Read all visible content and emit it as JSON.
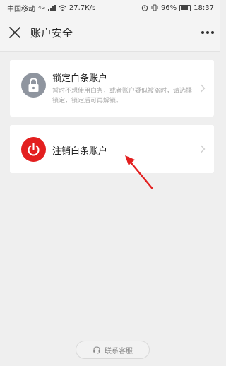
{
  "status_bar": {
    "carrier": "中国移动",
    "network": "4G",
    "speed": "27.7K/s",
    "battery": "96%",
    "time": "18:37"
  },
  "header": {
    "close_icon": "close-icon",
    "title": "账户安全",
    "more_icon": "more-icon"
  },
  "options": [
    {
      "icon": "lock-icon",
      "icon_bg": "#8f959f",
      "title": "锁定白条账户",
      "description": "暂时不想使用白条，或者账户疑似被盗时，请选择锁定，锁定后可再解锁。"
    },
    {
      "icon": "power-icon",
      "icon_bg": "#e31f1f",
      "title": "注销白条账户"
    }
  ],
  "annotation": {
    "arrow_color": "#e31f1f"
  },
  "footer": {
    "contact_icon": "headset-icon",
    "contact_label": "联系客服"
  }
}
